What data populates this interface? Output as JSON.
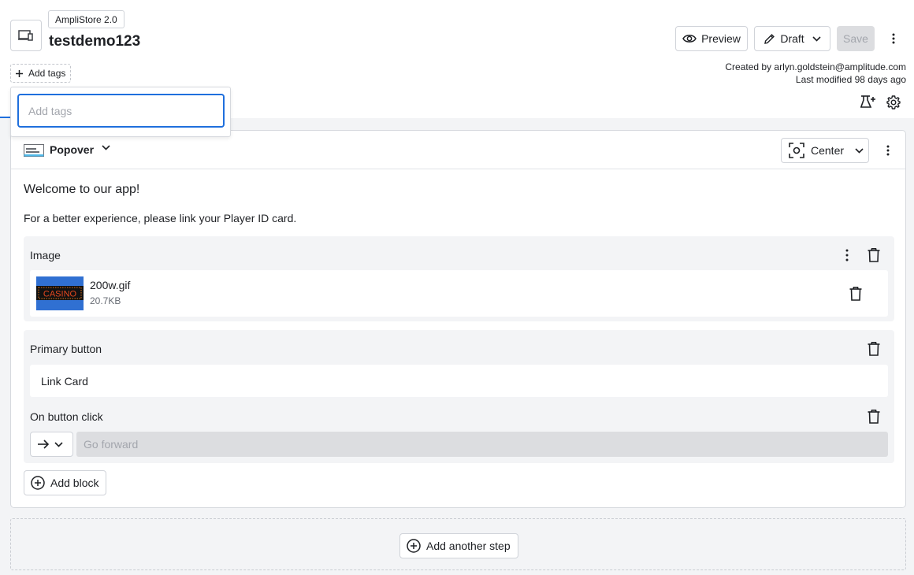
{
  "header": {
    "app_badge": "AmpliStore 2.0",
    "title": "testdemo123",
    "add_tags_label": "Add tags",
    "preview_label": "Preview",
    "draft_label": "Draft",
    "save_label": "Save",
    "created_by": "Created by arlyn.goldstein@amplitude.com",
    "last_modified": "Last modified 98 days ago"
  },
  "tags_popup": {
    "placeholder": "Add tags"
  },
  "step": {
    "type_label": "Popover",
    "position_label": "Center",
    "title_text": "Welcome to our app!",
    "body_text": "For a better experience, please link your Player ID card.",
    "image_block": {
      "label": "Image",
      "file_name": "200w.gif",
      "file_size": "20.7KB",
      "thumb_text": "CASINO"
    },
    "button_block": {
      "label": "Primary button",
      "button_text": "Link Card",
      "click_label": "On button click",
      "action_placeholder": "Go forward"
    },
    "add_block_label": "Add block"
  },
  "add_step_label": "Add another step",
  "colors": {
    "accent": "#1f6fdd",
    "block_bg": "#f3f4f6",
    "disabled_bg": "#dcdde0"
  },
  "icons": [
    "device-icon",
    "plus-icon",
    "eye-icon",
    "pencil-icon",
    "chevron-down-icon",
    "more-vertical-icon",
    "beaker-icon",
    "gear-icon",
    "popover-icon",
    "focus-icon",
    "trash-icon",
    "arrow-right-icon",
    "add-circle-icon"
  ]
}
